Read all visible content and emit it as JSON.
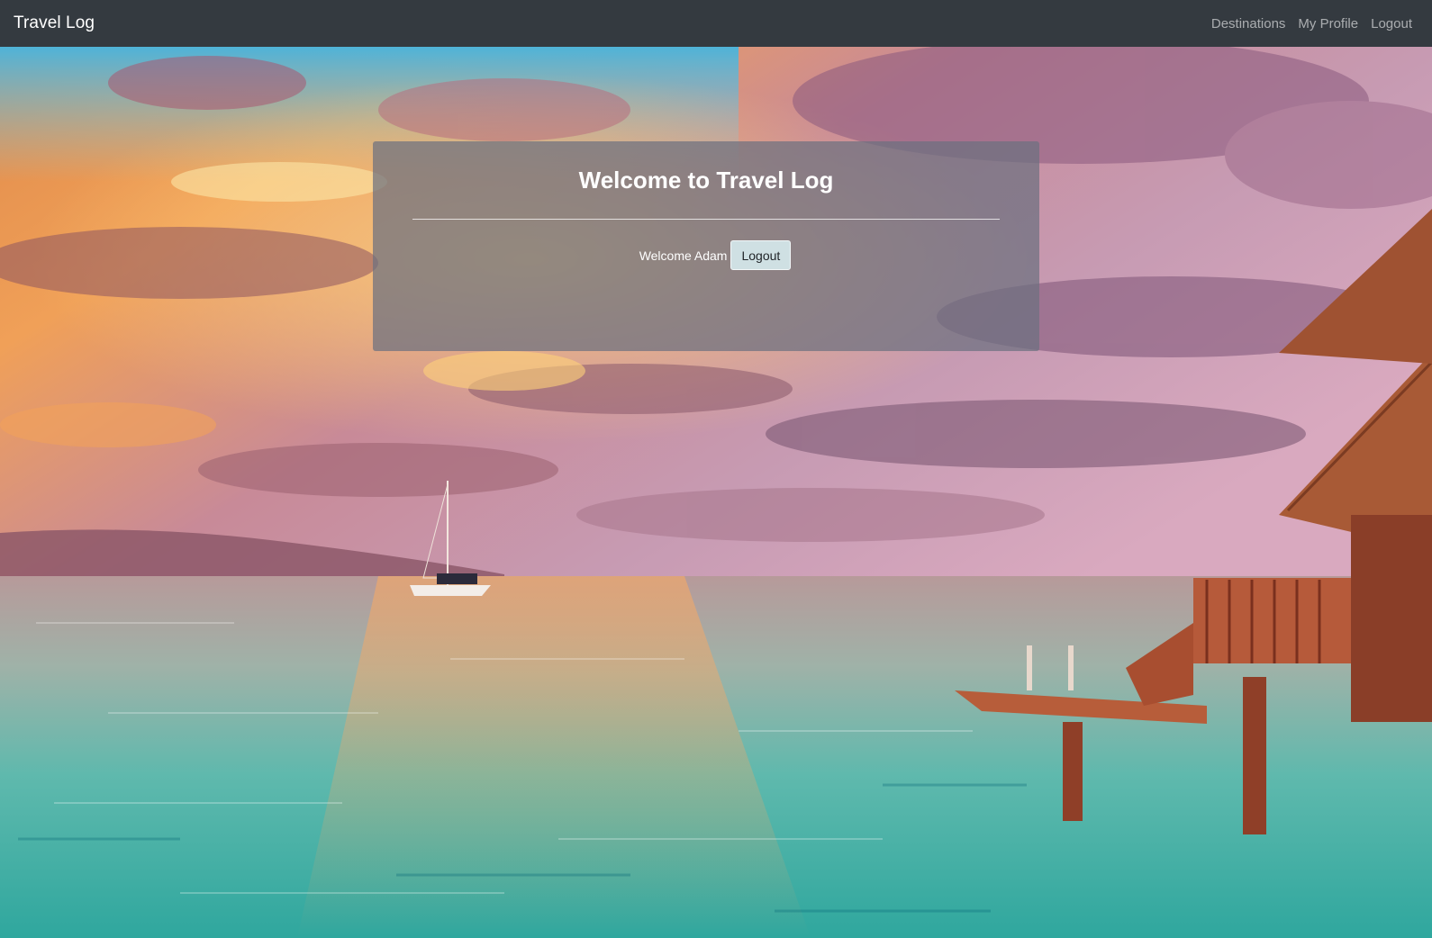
{
  "navbar": {
    "brand": "Travel Log",
    "links": [
      {
        "label": "Destinations"
      },
      {
        "label": "My Profile"
      },
      {
        "label": "Logout"
      }
    ]
  },
  "panel": {
    "title_prefix": "Welcome to",
    "title_brand": "Travel Log",
    "greeting": "Welcome Adam",
    "logout_label": "Logout"
  },
  "colors": {
    "navbar_bg": "#343a40",
    "panel_bg": "#6c7080",
    "button_bg": "#cfe0e3"
  }
}
